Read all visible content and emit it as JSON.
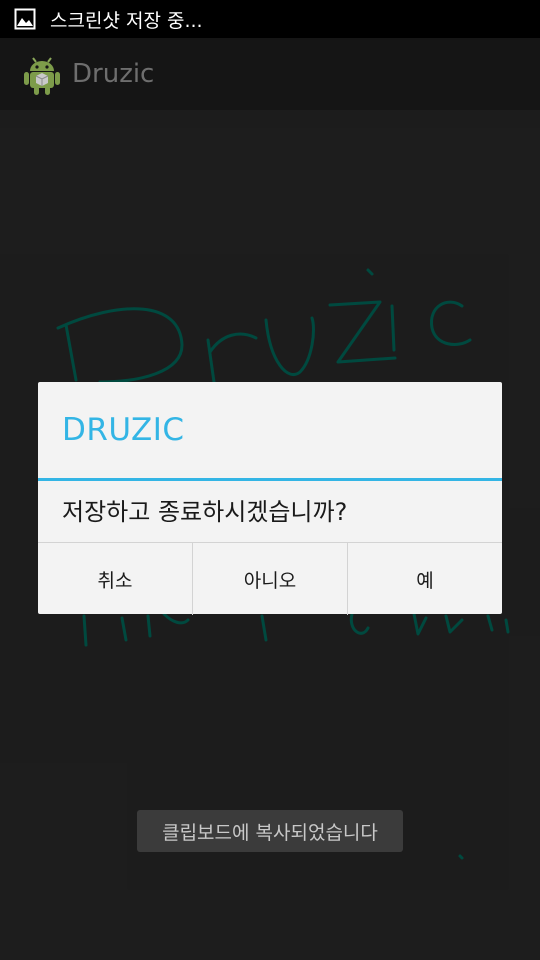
{
  "status_bar": {
    "notification_icon": "image-icon",
    "notification_text": "스크린샷 저장 중..."
  },
  "action_bar": {
    "app_icon": "android-icon",
    "title": "Druzic"
  },
  "canvas": {
    "drawing": "handwritten-drawing",
    "ink_color": "#00564a"
  },
  "dialog": {
    "title": "DRUZIC",
    "message": "저장하고 종료하시겠습니까?",
    "buttons": [
      {
        "label": "취소"
      },
      {
        "label": "아니오"
      },
      {
        "label": "예"
      }
    ],
    "accent_color": "#33b5e5"
  },
  "toast": {
    "text": "클립보드에 복사되었습니다"
  }
}
